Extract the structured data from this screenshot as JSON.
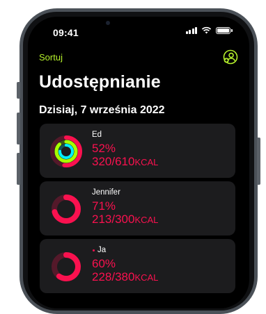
{
  "status_bar": {
    "time": "09:41"
  },
  "nav": {
    "sort_label": "Sortuj",
    "add_friend_icon": "person-add-icon",
    "accent_color": "#b6f22c"
  },
  "title": "Udostępnianie",
  "date_header": "Dzisiaj, 7 września 2022",
  "colors": {
    "move": "#fa114f",
    "exercise": "#a6ff00",
    "stand": "#00f0ff"
  },
  "friends": [
    {
      "name": "Ed",
      "percent": "52%",
      "kcal_value": "320/610",
      "kcal_unit": "KCAL",
      "move": 0.52,
      "exercise": 0.88,
      "stand": 0.75
    },
    {
      "name": "Jennifer",
      "percent": "71%",
      "kcal_value": "213/300",
      "kcal_unit": "KCAL",
      "move": 0.71
    },
    {
      "name": "Ja",
      "percent": "60%",
      "kcal_value": "228/380",
      "kcal_unit": "KCAL",
      "move": 0.6
    }
  ]
}
